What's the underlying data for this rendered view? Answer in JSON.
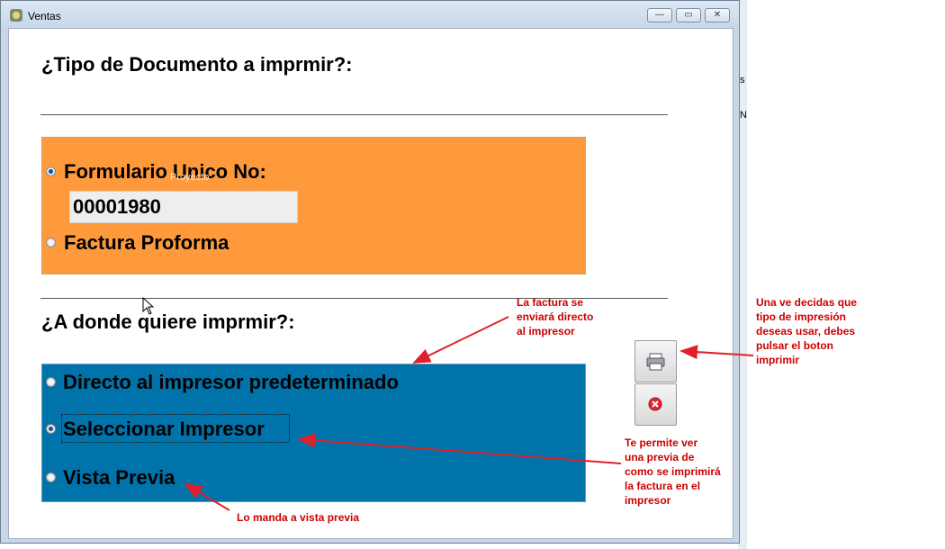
{
  "window": {
    "title": "Ventas"
  },
  "window_controls": {
    "minimize": "—",
    "restore": "▭",
    "close": "✕"
  },
  "section1": {
    "heading": "¿Tipo de Documento a imprmir?:",
    "options": [
      {
        "label": "Formulario Unico No:",
        "checked": true
      },
      {
        "label": "Factura Proforma",
        "checked": false
      }
    ],
    "number_value": "00001980",
    "overlay_label": "Proyecto",
    "panel_color": "#ff9a3c"
  },
  "section2": {
    "heading": "¿A donde quiere imprmir?:",
    "options": [
      {
        "label": "Directo al impresor predeterminado",
        "checked": false
      },
      {
        "label": "Seleccionar Impresor",
        "checked": true
      },
      {
        "label": "Vista Previa",
        "checked": false
      }
    ],
    "panel_color": "#0073aa"
  },
  "buttons": {
    "print_icon": "printer-icon",
    "cancel_icon": "cancel-x-icon"
  },
  "background_fragments": [
    "s",
    "N"
  ],
  "annotations": {
    "direct": [
      "La factura se",
      "enviará directo",
      "al impresor"
    ],
    "print_hint": [
      "Una ve decidas que",
      "tipo de impresión",
      "deseas usar, debes",
      "pulsar el boton",
      "imprimir"
    ],
    "preview_hint": [
      "Te permite ver",
      "una previa de",
      "como se imprimirá",
      "la factura en el",
      "impresor"
    ],
    "vista": "Lo manda a vista previa",
    "color": "#cc0000"
  }
}
